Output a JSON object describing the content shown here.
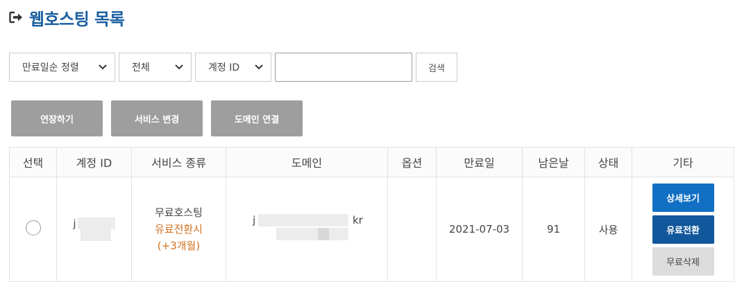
{
  "header": {
    "title": "웹호스팅 목록",
    "icon": "logout-arrow-icon"
  },
  "filters": {
    "sort_value": "만료일순 정렬",
    "scope_value": "전체",
    "field_value": "계정 ID",
    "search_value": "",
    "search_label": "검색"
  },
  "actions": {
    "extend_label": "연장하기",
    "change_service_label": "서비스 변경",
    "connect_domain_label": "도메인 연결"
  },
  "table": {
    "columns": [
      "선택",
      "계정 ID",
      "서비스 종류",
      "도메인",
      "옵션",
      "만료일",
      "남은날",
      "상태",
      "기타"
    ],
    "rows": [
      {
        "account_id_visible": "j",
        "service_type": "무료호스팅",
        "service_note": "유료전환시",
        "service_extra": "(+3개월)",
        "domain_prefix": "j",
        "domain_suffix": "kr",
        "option": "",
        "expiry": "2021-07-03",
        "days_left": "91",
        "status": "사용",
        "btn_detail": "상세보기",
        "btn_convert": "유료전환",
        "btn_delete": "무료삭제"
      }
    ]
  },
  "colors": {
    "title": "#1a5fa0",
    "accent_blue": "#1270c4",
    "dark_blue": "#11579c",
    "orange_note": "#d0701e",
    "gray_button": "#9e9e9e"
  }
}
